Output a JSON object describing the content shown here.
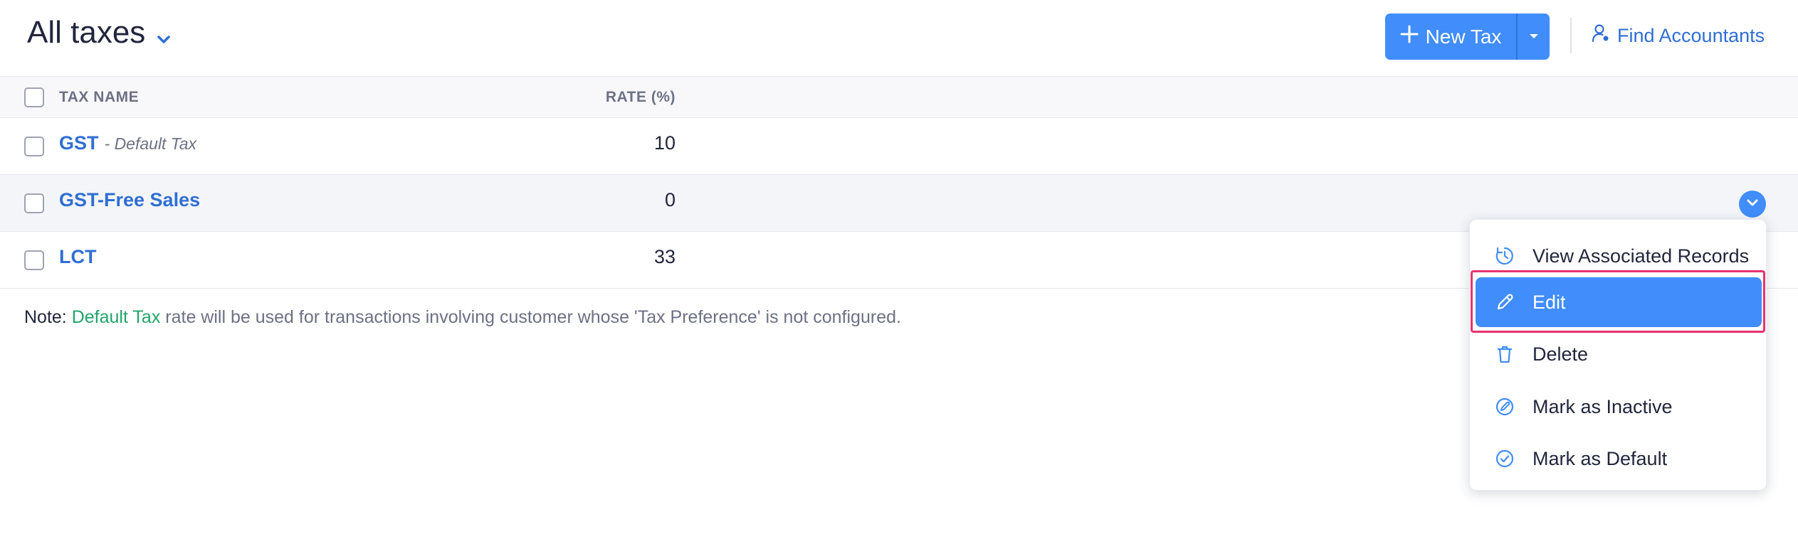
{
  "header": {
    "title": "All taxes",
    "new_button_label": "New Tax",
    "find_accountants_label": "Find Accountants"
  },
  "table": {
    "columns": [
      "TAX NAME",
      "RATE (%)"
    ],
    "rows": [
      {
        "name": "GST",
        "default_label": "- Default Tax",
        "rate": "10"
      },
      {
        "name": "GST-Free Sales",
        "default_label": "",
        "rate": "0"
      },
      {
        "name": "LCT",
        "default_label": "",
        "rate": "33"
      }
    ]
  },
  "note": {
    "label": "Note:",
    "highlight": "Default Tax",
    "text": "rate will be used for transactions involving customer whose 'Tax Preference' is not configured."
  },
  "row_menu": {
    "items": [
      {
        "label": "View Associated Records",
        "icon": "history-icon"
      },
      {
        "label": "Edit",
        "icon": "pencil-icon",
        "active": true
      },
      {
        "label": "Delete",
        "icon": "trash-icon"
      },
      {
        "label": "Mark as Inactive",
        "icon": "inactive-icon"
      },
      {
        "label": "Mark as Default",
        "icon": "check-circle-icon"
      }
    ]
  },
  "colors": {
    "accent": "#408dfb",
    "link": "#2f6ed4",
    "highlight_green": "#1fa56a",
    "focus_outline": "#e8336d"
  }
}
